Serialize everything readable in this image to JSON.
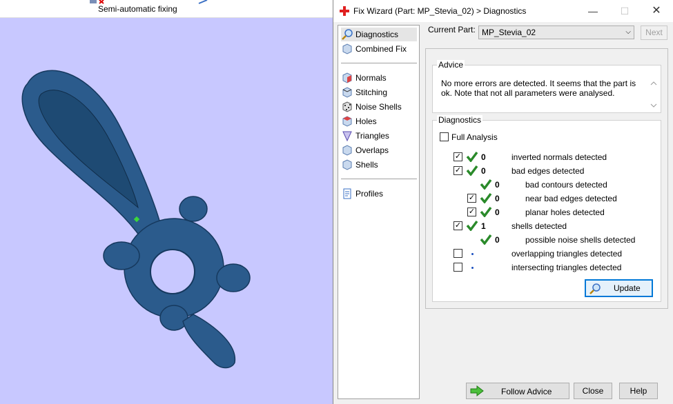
{
  "toolbar": {
    "label": "Semi-automatic fixing"
  },
  "dialog": {
    "title": "Fix Wizard (Part: MP_Stevia_02) > Diagnostics",
    "nav": {
      "items": [
        {
          "label": "Diagnostics"
        },
        {
          "label": "Combined Fix"
        },
        {
          "label": "Normals"
        },
        {
          "label": "Stitching"
        },
        {
          "label": "Noise Shells"
        },
        {
          "label": "Holes"
        },
        {
          "label": "Triangles"
        },
        {
          "label": "Overlaps"
        },
        {
          "label": "Shells"
        },
        {
          "label": "Profiles"
        }
      ]
    },
    "current_part_label": "Current Part:",
    "current_part_value": "MP_Stevia_02",
    "next_label": "Next",
    "advice": {
      "title": "Advice",
      "text": "No more errors are detected. It seems that the part is ok. Note that not all parameters were analysed."
    },
    "diagnostics": {
      "title": "Diagnostics",
      "full_analysis": "Full Analysis",
      "rows": [
        {
          "count": "0",
          "label": "inverted normals detected"
        },
        {
          "count": "0",
          "label": "bad edges detected"
        },
        {
          "count": "0",
          "label": "bad contours detected"
        },
        {
          "count": "0",
          "label": "near bad edges detected"
        },
        {
          "count": "0",
          "label": "planar holes detected"
        },
        {
          "count": "1",
          "label": "shells detected"
        },
        {
          "count": "0",
          "label": "possible noise shells detected"
        },
        {
          "count": "",
          "label": "overlapping triangles detected"
        },
        {
          "count": "",
          "label": "intersecting triangles detected"
        }
      ],
      "update_label": "Update"
    },
    "buttons": {
      "follow_advice": "Follow Advice",
      "close": "Close",
      "help": "Help"
    }
  }
}
